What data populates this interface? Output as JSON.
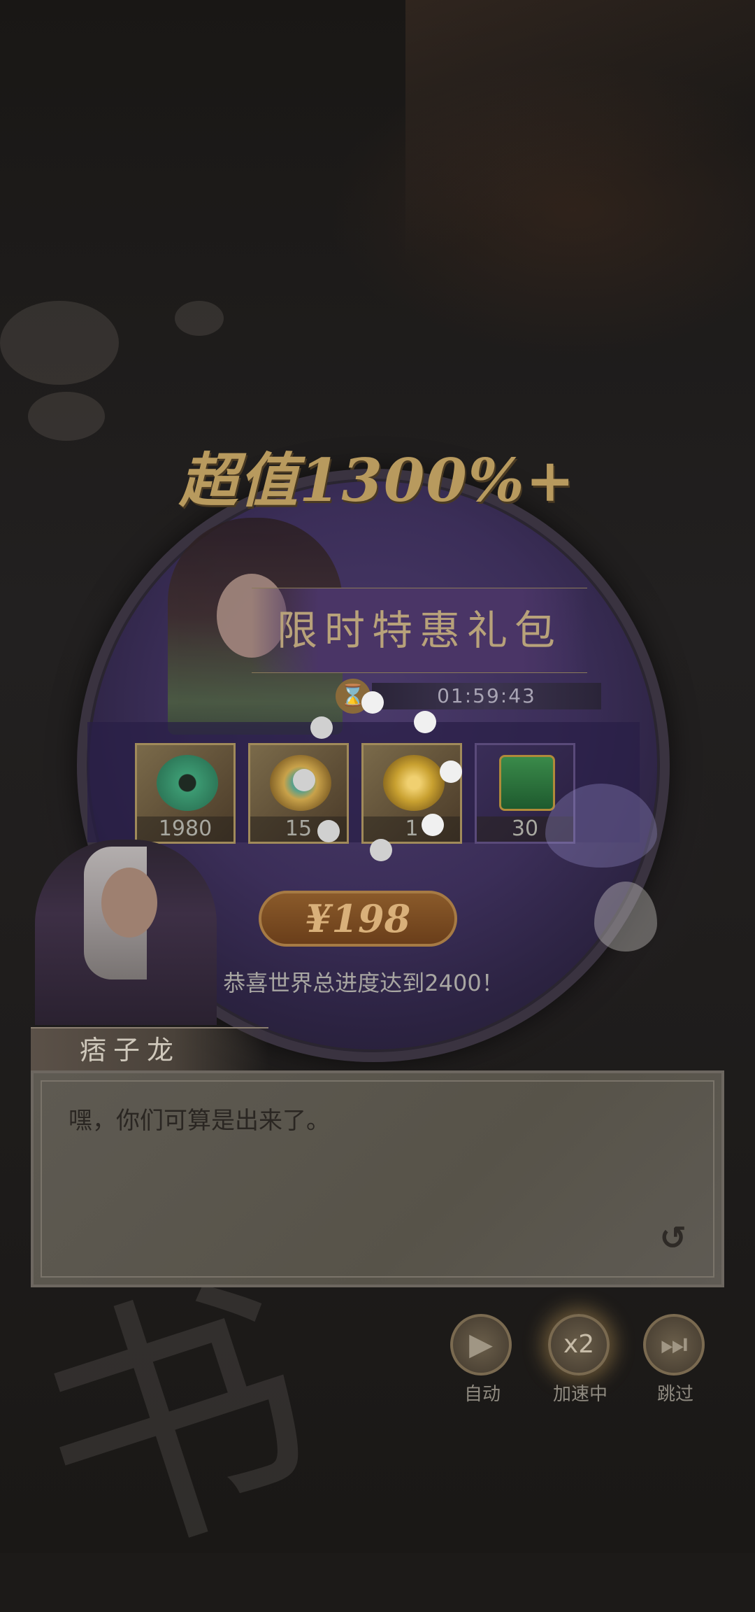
{
  "popup": {
    "headline": "超值1300%+",
    "banner_title": "限时特惠礼包",
    "timer": "01:59:43",
    "items": [
      {
        "count": "1980",
        "icon": "jade-pendant-icon"
      },
      {
        "count": "15",
        "icon": "gold-gem-icon"
      },
      {
        "count": "1",
        "icon": "gold-ring-icon"
      },
      {
        "count": "30",
        "icon": "green-chest-icon"
      }
    ],
    "price": "¥198",
    "progress_message": "恭喜世界总进度达到2400！"
  },
  "dialog": {
    "speaker_name": "痞子龙",
    "text": "嘿，你们可算是出来了。"
  },
  "controls": {
    "auto_label": "自动",
    "speed_label": "加速中",
    "speed_badge": "x2",
    "skip_label": "跳过"
  },
  "colors": {
    "accent_gold": "#b89a5e",
    "popup_purple": "#3b2e58",
    "dialog_bg": "#5e5a52"
  }
}
